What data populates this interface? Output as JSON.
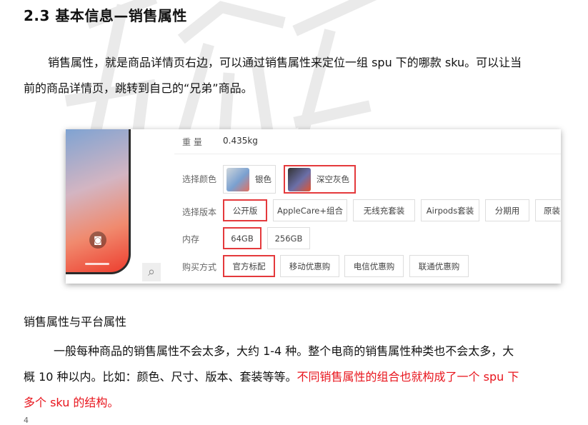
{
  "heading": "2.3 基本信息—销售属性",
  "intro": "销售属性，就是商品详情页右边，可以通过销售属性来定位一组 spu 下的哪款 sku。可以让当前的商品详情页，跳转到自己的“兄弟”商品。",
  "product_panel": {
    "weight_label": "重    量",
    "weight_value": "0.435kg",
    "color_label": "选择颜色",
    "colors": [
      "银色",
      "深空灰色"
    ],
    "version_label": "选择版本",
    "versions": [
      "公开版",
      "AppleCare+组合",
      "无线充套装",
      "Airpods套装",
      "分期用",
      "原装"
    ],
    "memory_label": "内存",
    "memories": [
      "64GB",
      "256GB"
    ],
    "purchase_label": "购买方式",
    "purchase_options": [
      "官方标配",
      "移动优惠购",
      "电信优惠购",
      "联通优惠购"
    ],
    "accent_color": "#e4393c"
  },
  "subheading": "销售属性与平台属性",
  "body": {
    "normal": "一般每种商品的销售属性不会太多，大约 1-4 种。整个电商的销售属性种类也不会太多，大概 10 种以内。比如：颜色、尺寸、版本、套装等等。",
    "highlight": "不同销售属性的组合也就构成了一个 spu 下多个 sku 的结构。",
    "highlight_color": "#e8141c"
  },
  "page_number": "4"
}
